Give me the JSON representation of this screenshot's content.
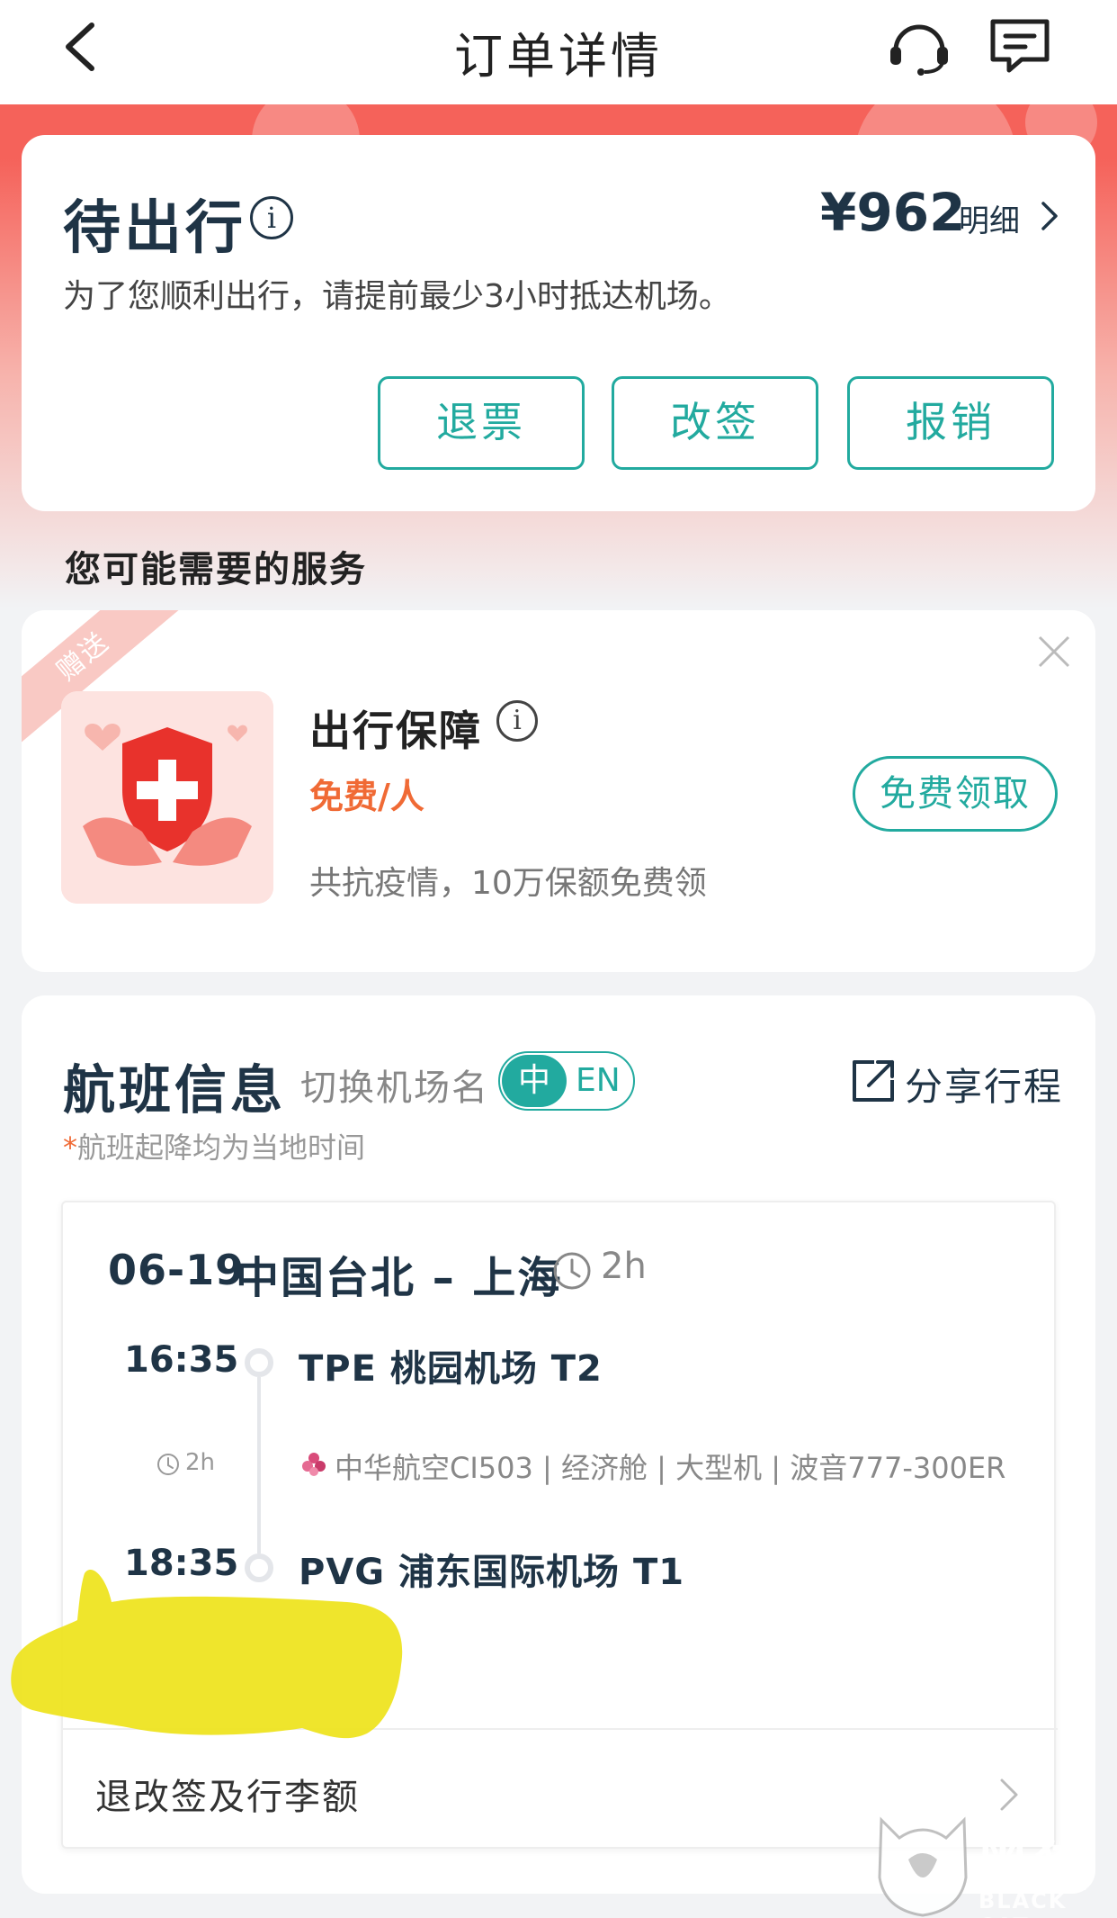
{
  "header": {
    "title": "订单详情",
    "icons": [
      "back-icon",
      "customer-service-icon",
      "message-icon"
    ]
  },
  "status": {
    "title": "待出行",
    "price": "¥962",
    "price_detail": "明细",
    "subtitle": "为了您顺利出行，请提前最少3小时抵达机场。",
    "buttons": {
      "refund": "退票",
      "change": "改签",
      "reimburse": "报销"
    }
  },
  "services": {
    "heading": "您可能需要的服务",
    "ribbon": "赠送",
    "name": "出行保障",
    "price": "免费/人",
    "description": "共抗疫情，10万保额免费领",
    "claim_button": "免费领取"
  },
  "flight": {
    "heading": "航班信息",
    "switch_label": "切换机场名",
    "lang_zh": "中",
    "lang_en": "EN",
    "share_label": "分享行程",
    "note_star": "*",
    "note": "航班起降均为当地时间",
    "segment": {
      "date": "06-19",
      "route": "中国台北 – 上海",
      "duration": "2h",
      "departure_time": "16:35",
      "departure_airport": "TPE 桃园机场 T2",
      "leg_duration": "2h",
      "flight_details": "中华航空CI503 | 经济舱 | 大型机 | 波音777-300ER",
      "arrival_time": "18:35",
      "arrival_airport": "PVG 浦东国际机场 T1",
      "rules_label": "退改签及行李额"
    }
  },
  "watermark": {
    "text": "黑猫",
    "sub": "BLACK CAT"
  },
  "colors": {
    "accent": "#22aa9f",
    "brand_red": "#f5625a",
    "price_orange": "#f06a35",
    "title_navy": "#1f3446"
  }
}
